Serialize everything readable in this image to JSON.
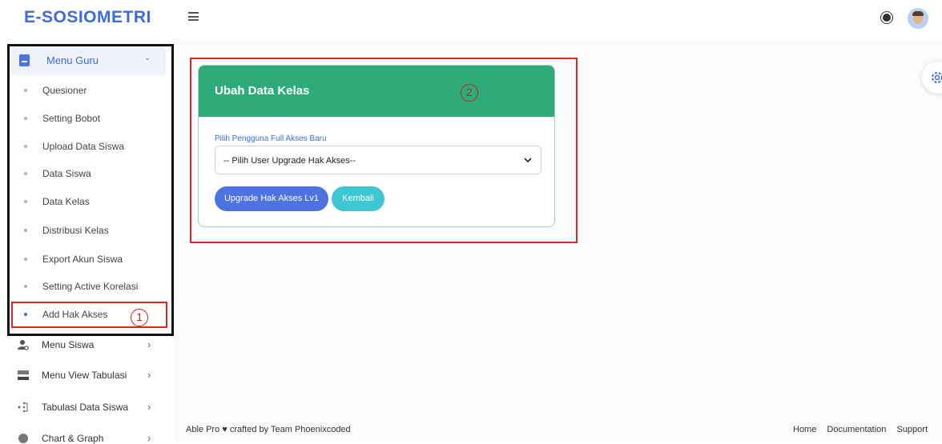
{
  "app": {
    "logo": "E-SOSIOMETRI"
  },
  "sidebar": {
    "menu_guru": {
      "label": "Menu Guru",
      "chevron": "⌄"
    },
    "sub_items": [
      {
        "label": "Quesioner"
      },
      {
        "label": "Setting Bobot"
      },
      {
        "label": "Upload Data Siswa"
      },
      {
        "label": "Data Siswa"
      },
      {
        "label": "Data Kelas"
      },
      {
        "label": "Distribusi Kelas"
      },
      {
        "label": "Export Akun Siswa"
      },
      {
        "label": "Setting Active Korelasi"
      },
      {
        "label": "Add Hak Akses",
        "active": true
      }
    ],
    "nav": [
      {
        "label": "Menu Siswa",
        "icon": "user-gear-icon"
      },
      {
        "label": "Menu View Tabulasi",
        "icon": "layout-icon"
      },
      {
        "label": "Tabulasi Data Siswa",
        "icon": "table-dots-icon"
      },
      {
        "label": "Chart & Graph",
        "icon": "chart-icon"
      }
    ],
    "arrow": "›"
  },
  "annotations": {
    "marker1": "1",
    "marker2": "2"
  },
  "card": {
    "title": "Ubah Data Kelas",
    "field_label": "Pilih Pengguna Full Akses Baru",
    "select_value": "-- Pilih User Upgrade Hak Akses--",
    "btn_upgrade": "Upgrade Hak Akses Lv1",
    "btn_back": "Kembali"
  },
  "footer": {
    "credit": "Able Pro ♥ crafted by Team Phoenixcoded",
    "links": [
      "Home",
      "Documentation",
      "Support"
    ]
  },
  "colors": {
    "primary": "#4d73e3",
    "success": "#2fab79",
    "info": "#3ec7d3",
    "annotation": "#e02424"
  }
}
